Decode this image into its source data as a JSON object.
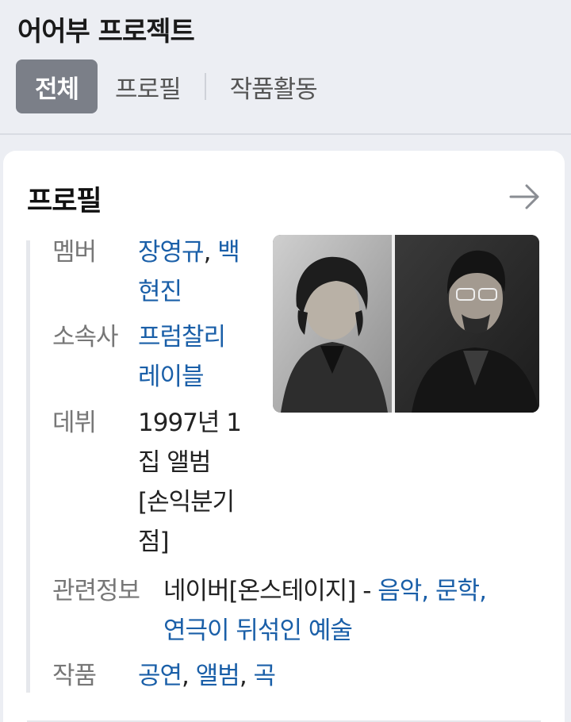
{
  "header": {
    "title": "어어부 프로젝트",
    "tabs": [
      {
        "label": "전체"
      },
      {
        "label": "프로필"
      },
      {
        "label": "작품활동"
      }
    ]
  },
  "profile": {
    "title": "프로필",
    "member_label": "멤버",
    "member_name1": "장영규",
    "member_sep": ",",
    "member_name2_line1": "백",
    "member_name2_line2": "현진",
    "agency_label": "소속사",
    "agency_line1": "프럼찰리",
    "agency_line2": "레이블",
    "debut_label": "데뷔",
    "debut_line1": "1997년 1",
    "debut_line2": "집 앨범",
    "debut_line3": "[손익분기",
    "debut_line4": "점]",
    "related_label": "관련정보",
    "related_prefix": "네이버[온스테이지] - ",
    "related_link1": "음악",
    "related_sep1": ", ",
    "related_link2": "문학",
    "related_sep2": ",",
    "related_link3": "연극이 뒤섞인 예술",
    "works_label": "작품",
    "works_link1": "공연",
    "works_sep1": ", ",
    "works_link2": "앨범",
    "works_sep2": ", ",
    "works_link3": "곡"
  }
}
